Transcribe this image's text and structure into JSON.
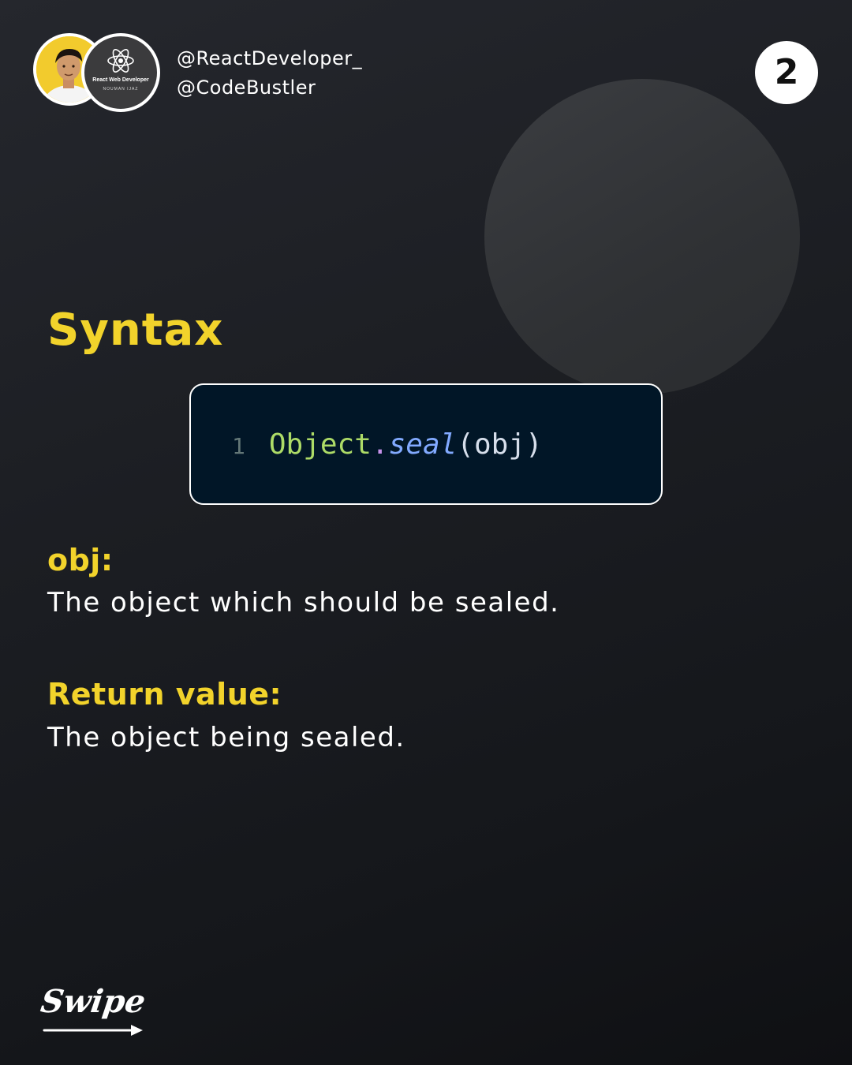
{
  "header": {
    "logo_title": "React Web Developer",
    "logo_subtitle": "NOUMAN IJAZ",
    "handle_primary": "@ReactDeveloper_",
    "handle_secondary": "@CodeBustler",
    "page_number": "2"
  },
  "main": {
    "title": "Syntax",
    "code": {
      "line_number": "1",
      "object": "Object",
      "dot": ".",
      "method": "seal",
      "open_paren": "(",
      "argument": "obj",
      "close_paren": ")"
    },
    "params": [
      {
        "label": "obj:",
        "description": "The object which should be sealed."
      },
      {
        "label": "Return value:",
        "description": "The object being sealed."
      }
    ]
  },
  "footer": {
    "swipe_label": "Swipe"
  },
  "colors": {
    "accent_yellow": "#f2d32b",
    "code_background": "#011627",
    "code_object": "#addb67",
    "code_method": "#82aaff"
  },
  "icons": [
    "react-atom-icon",
    "swipe-arrow-icon"
  ]
}
